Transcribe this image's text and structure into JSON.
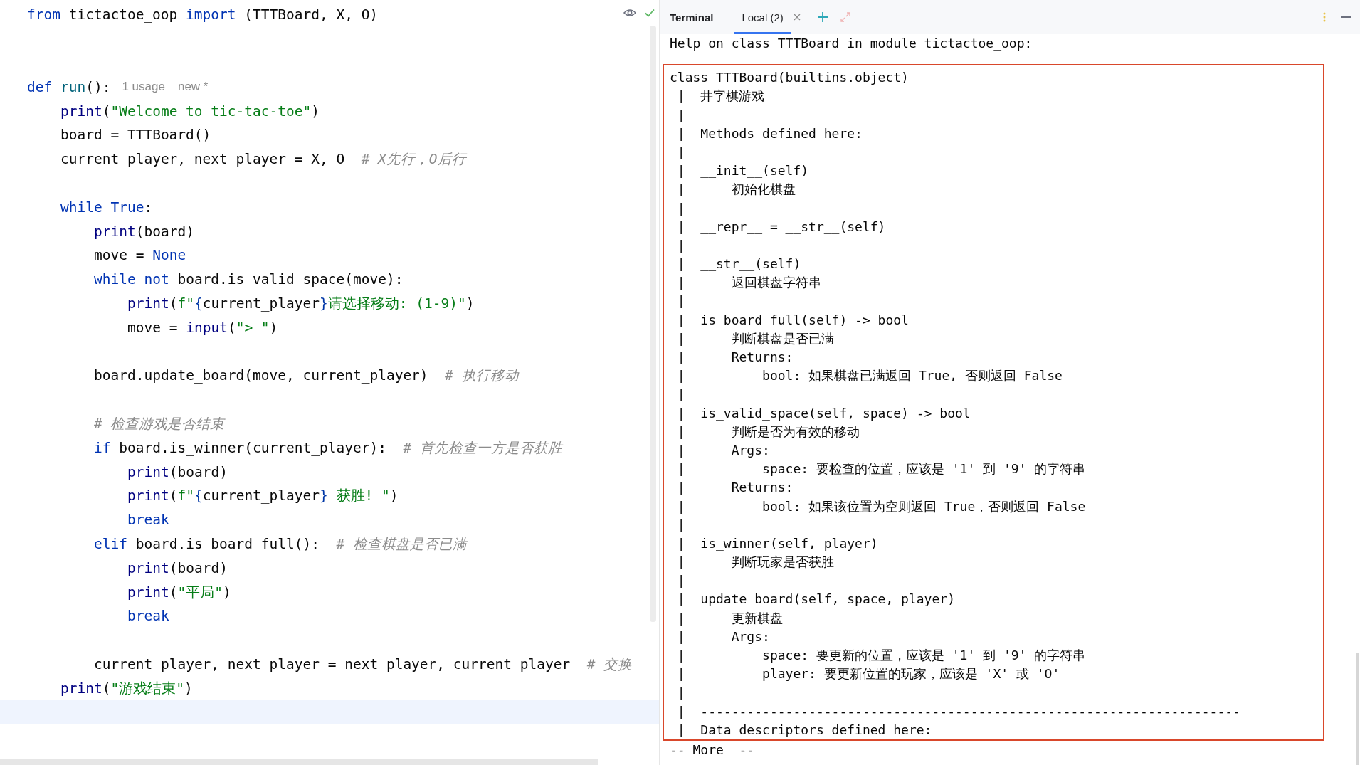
{
  "editor": {
    "lines": [
      {
        "kind": "code",
        "tokens": [
          {
            "kind": "keyword",
            "t": "from"
          },
          {
            "kind": "plain",
            "t": " tictactoe_oop "
          },
          {
            "kind": "keyword",
            "t": "import"
          },
          {
            "kind": "plain",
            "t": " (TTTBoard, X, O)"
          }
        ]
      },
      {
        "kind": "blank"
      },
      {
        "kind": "blank"
      },
      {
        "kind": "code",
        "tokens": [
          {
            "kind": "keyword",
            "t": "def"
          },
          {
            "kind": "funcdef",
            "t": " run"
          },
          {
            "kind": "plain",
            "t": "():"
          }
        ],
        "hints": [
          "1 usage",
          "new *"
        ],
        "children": [
          {
            "kind": "code",
            "tokens": [
              {
                "kind": "builtin",
                "t": "print"
              },
              {
                "kind": "plain",
                "t": "("
              },
              {
                "kind": "string",
                "t": "\"Welcome to tic-tac-toe\""
              },
              {
                "kind": "plain",
                "t": ")"
              }
            ]
          },
          {
            "kind": "code",
            "tokens": [
              {
                "kind": "plain",
                "t": "board = TTTBoard()"
              }
            ]
          },
          {
            "kind": "code",
            "tokens": [
              {
                "kind": "plain",
                "t": "current_player, next_player = X, O  "
              },
              {
                "kind": "comment",
                "t": "# X先行，O后行"
              }
            ]
          },
          {
            "kind": "blank"
          },
          {
            "kind": "code",
            "tokens": [
              {
                "kind": "keyword",
                "t": "while"
              },
              {
                "kind": "keyword",
                "t": " True"
              },
              {
                "kind": "plain",
                "t": ":"
              }
            ],
            "children": [
              {
                "kind": "code",
                "tokens": [
                  {
                    "kind": "builtin",
                    "t": "print"
                  },
                  {
                    "kind": "plain",
                    "t": "(board)"
                  }
                ]
              },
              {
                "kind": "code",
                "tokens": [
                  {
                    "kind": "plain",
                    "t": "move = "
                  },
                  {
                    "kind": "keyword",
                    "t": "None"
                  }
                ]
              },
              {
                "kind": "code",
                "tokens": [
                  {
                    "kind": "keyword",
                    "t": "while"
                  },
                  {
                    "kind": "keyword",
                    "t": " not"
                  },
                  {
                    "kind": "plain",
                    "t": " board.is_valid_space(move):"
                  }
                ],
                "children": [
                  {
                    "kind": "code",
                    "tokens": [
                      {
                        "kind": "builtin",
                        "t": "print"
                      },
                      {
                        "kind": "plain",
                        "t": "("
                      },
                      {
                        "kind": "string",
                        "t": "f\""
                      },
                      {
                        "kind": "brace",
                        "t": "{"
                      },
                      {
                        "kind": "plain",
                        "t": "current_player"
                      },
                      {
                        "kind": "brace",
                        "t": "}"
                      },
                      {
                        "kind": "string",
                        "t": "请选择移动: (1-9)\""
                      },
                      {
                        "kind": "plain",
                        "t": ")"
                      }
                    ]
                  },
                  {
                    "kind": "code",
                    "tokens": [
                      {
                        "kind": "plain",
                        "t": "move = "
                      },
                      {
                        "kind": "builtin",
                        "t": "input"
                      },
                      {
                        "kind": "plain",
                        "t": "("
                      },
                      {
                        "kind": "string",
                        "t": "\"> \""
                      },
                      {
                        "kind": "plain",
                        "t": ")"
                      }
                    ]
                  }
                ]
              },
              {
                "kind": "blank"
              },
              {
                "kind": "code",
                "tokens": [
                  {
                    "kind": "plain",
                    "t": "board.update_board(move, current_player)  "
                  },
                  {
                    "kind": "comment",
                    "t": "# 执行移动"
                  }
                ]
              },
              {
                "kind": "blank"
              },
              {
                "kind": "code",
                "tokens": [
                  {
                    "kind": "comment",
                    "t": "# 检查游戏是否结束"
                  }
                ]
              },
              {
                "kind": "code",
                "tokens": [
                  {
                    "kind": "keyword",
                    "t": "if"
                  },
                  {
                    "kind": "plain",
                    "t": " board.is_winner(current_player):  "
                  },
                  {
                    "kind": "comment",
                    "t": "# 首先检查一方是否获胜"
                  }
                ],
                "children": [
                  {
                    "kind": "code",
                    "tokens": [
                      {
                        "kind": "builtin",
                        "t": "print"
                      },
                      {
                        "kind": "plain",
                        "t": "(board)"
                      }
                    ]
                  },
                  {
                    "kind": "code",
                    "tokens": [
                      {
                        "kind": "builtin",
                        "t": "print"
                      },
                      {
                        "kind": "plain",
                        "t": "("
                      },
                      {
                        "kind": "string",
                        "t": "f\""
                      },
                      {
                        "kind": "brace",
                        "t": "{"
                      },
                      {
                        "kind": "plain",
                        "t": "current_player"
                      },
                      {
                        "kind": "brace",
                        "t": "}"
                      },
                      {
                        "kind": "string",
                        "t": " 获胜! \""
                      },
                      {
                        "kind": "plain",
                        "t": ")"
                      }
                    ]
                  },
                  {
                    "kind": "code",
                    "tokens": [
                      {
                        "kind": "keyword",
                        "t": "break"
                      }
                    ]
                  }
                ]
              },
              {
                "kind": "code",
                "tokens": [
                  {
                    "kind": "keyword",
                    "t": "elif"
                  },
                  {
                    "kind": "plain",
                    "t": " board.is_board_full():  "
                  },
                  {
                    "kind": "comment",
                    "t": "# 检查棋盘是否已满"
                  }
                ],
                "children": [
                  {
                    "kind": "code",
                    "tokens": [
                      {
                        "kind": "builtin",
                        "t": "print"
                      },
                      {
                        "kind": "plain",
                        "t": "(board)"
                      }
                    ]
                  },
                  {
                    "kind": "code",
                    "tokens": [
                      {
                        "kind": "builtin",
                        "t": "print"
                      },
                      {
                        "kind": "plain",
                        "t": "("
                      },
                      {
                        "kind": "string",
                        "t": "\"平局\""
                      },
                      {
                        "kind": "plain",
                        "t": ")"
                      }
                    ]
                  },
                  {
                    "kind": "code",
                    "tokens": [
                      {
                        "kind": "keyword",
                        "t": "break"
                      }
                    ]
                  }
                ]
              },
              {
                "kind": "blank"
              },
              {
                "kind": "code",
                "tokens": [
                  {
                    "kind": "plain",
                    "t": "current_player, next_player = next_player, current_player  "
                  },
                  {
                    "kind": "comment",
                    "t": "# 交换"
                  }
                ]
              }
            ]
          },
          {
            "kind": "code",
            "tokens": [
              {
                "kind": "builtin",
                "t": "print"
              },
              {
                "kind": "plain",
                "t": "("
              },
              {
                "kind": "string",
                "t": "\"游戏结束\""
              },
              {
                "kind": "plain",
                "t": ")"
              }
            ]
          }
        ]
      },
      {
        "kind": "active"
      },
      {
        "kind": "blank"
      }
    ]
  },
  "terminal": {
    "title": "Terminal",
    "tabs": [
      {
        "label": "Local (2)",
        "selected": true
      }
    ],
    "header_line": "Help on class TTTBoard in module tictactoe_oop:",
    "boxed_lines": [
      "class TTTBoard(builtins.object)",
      " |  井字棋游戏",
      " |",
      " |  Methods defined here:",
      " |",
      " |  __init__(self)",
      " |      初始化棋盘",
      " |",
      " |  __repr__ = __str__(self)",
      " |",
      " |  __str__(self)",
      " |      返回棋盘字符串",
      " |",
      " |  is_board_full(self) -> bool",
      " |      判断棋盘是否已满",
      " |      Returns:",
      " |          bool: 如果棋盘已满返回 True, 否则返回 False",
      " |",
      " |  is_valid_space(self, space) -> bool",
      " |      判断是否为有效的移动",
      " |      Args:",
      " |          space: 要检查的位置，应该是 '1' 到 '9' 的字符串",
      " |      Returns:",
      " |          bool: 如果该位置为空则返回 True，否则返回 False",
      " |",
      " |  is_winner(self, player)",
      " |      判断玩家是否获胜",
      " |",
      " |  update_board(self, space, player)",
      " |      更新棋盘",
      " |      Args:",
      " |          space: 要更新的位置，应该是 '1' 到 '9' 的字符串",
      " |          player: 要更新位置的玩家，应该是 'X' 或 'O'",
      " |",
      " |  ----------------------------------------------------------------------",
      " |  Data descriptors defined here:"
    ],
    "pager_line": "-- More  --"
  }
}
